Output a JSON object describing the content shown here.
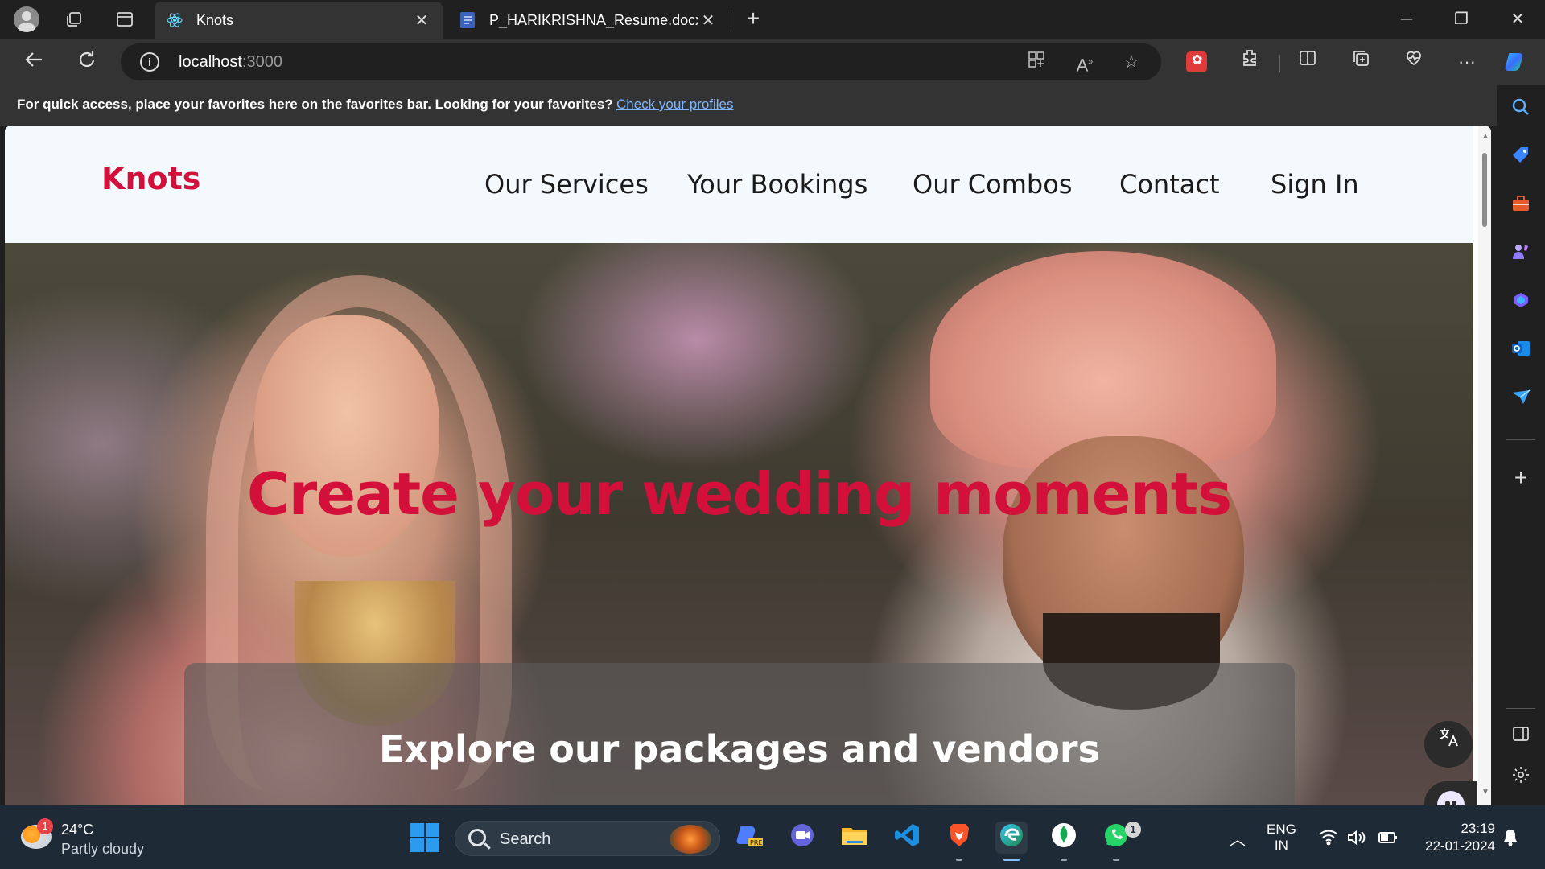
{
  "browser": {
    "tabs": [
      {
        "title": "Knots",
        "favicon": "react-icon",
        "active": true
      },
      {
        "title": "P_HARIKRISHNA_Resume.docx -",
        "favicon": "word-doc-icon",
        "active": false
      }
    ],
    "address": {
      "host": "localhost",
      "port": ":3000"
    },
    "favorites_bar": {
      "message": "For quick access, place your favorites here on the favorites bar. Looking for your favorites?",
      "link": "Check your profiles"
    }
  },
  "site": {
    "brand": "Knots",
    "nav": [
      "Our Services",
      "Your Bookings",
      "Our Combos",
      "Contact",
      "Sign In"
    ],
    "hero": {
      "title": "Create your wedding moments",
      "panel_text": "Explore our packages and vendors"
    },
    "colors": {
      "accent": "#d3103a",
      "nav_bg": "#f4f9fd"
    }
  },
  "taskbar": {
    "weather": {
      "temp": "24°C",
      "condition": "Partly cloudy",
      "badge": "1"
    },
    "search_label": "Search",
    "whatsapp_badge": "1",
    "language": {
      "lang": "ENG",
      "region": "IN"
    },
    "time": "23:19",
    "date": "22-01-2024"
  }
}
